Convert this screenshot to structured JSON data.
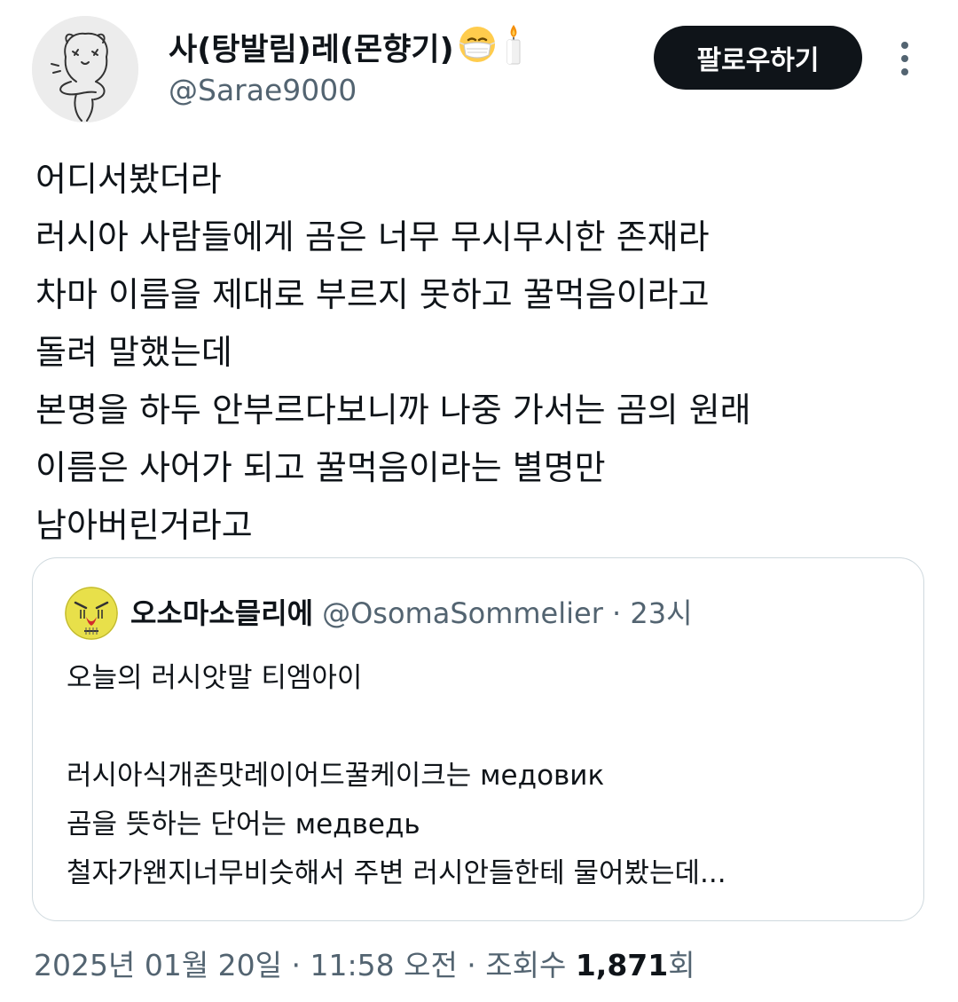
{
  "author": {
    "display_name": "사(탕발림)레(몬향기)",
    "emoji_1": "face-with-medical-mask-icon",
    "emoji_2": "candle-icon",
    "handle": "@Sarae9000"
  },
  "follow_button": {
    "label": "팔로우하기"
  },
  "more_icon": "more-vertical-icon",
  "tweet": {
    "lines": [
      "어디서봤더라",
      "러시아 사람들에게 곰은 너무 무시무시한 존재라",
      "차마 이름을 제대로 부르지 못하고 꿀먹음이라고",
      "돌려 말했는데",
      "본명을 하두 안부르다보니까 나중 가서는 곰의 원래",
      "이름은 사어가 되고 꿀먹음이라는 별명만",
      "남아버린거라고"
    ]
  },
  "quote": {
    "name": "오소마소믈리에",
    "handle_time": "@OsomaSommelier · 23시",
    "lines": [
      "오늘의 러시앗말 티엠아이",
      "",
      "러시아식개존맛레이어드꿀케이크는 медовик",
      "곰을 뜻하는 단어는 медведь",
      "철자가왠지너무비슷해서 주변 러시안들한테 물어봤는데..."
    ]
  },
  "footer": {
    "date_time": "2025년 01월 20일 · 11:58 오전 · 조회수 ",
    "views": "1,871",
    "views_suffix": "회"
  },
  "colors": {
    "text": "#0f1419",
    "secondary": "#536471",
    "border": "#cfd9de",
    "button_bg": "#0f1419"
  }
}
